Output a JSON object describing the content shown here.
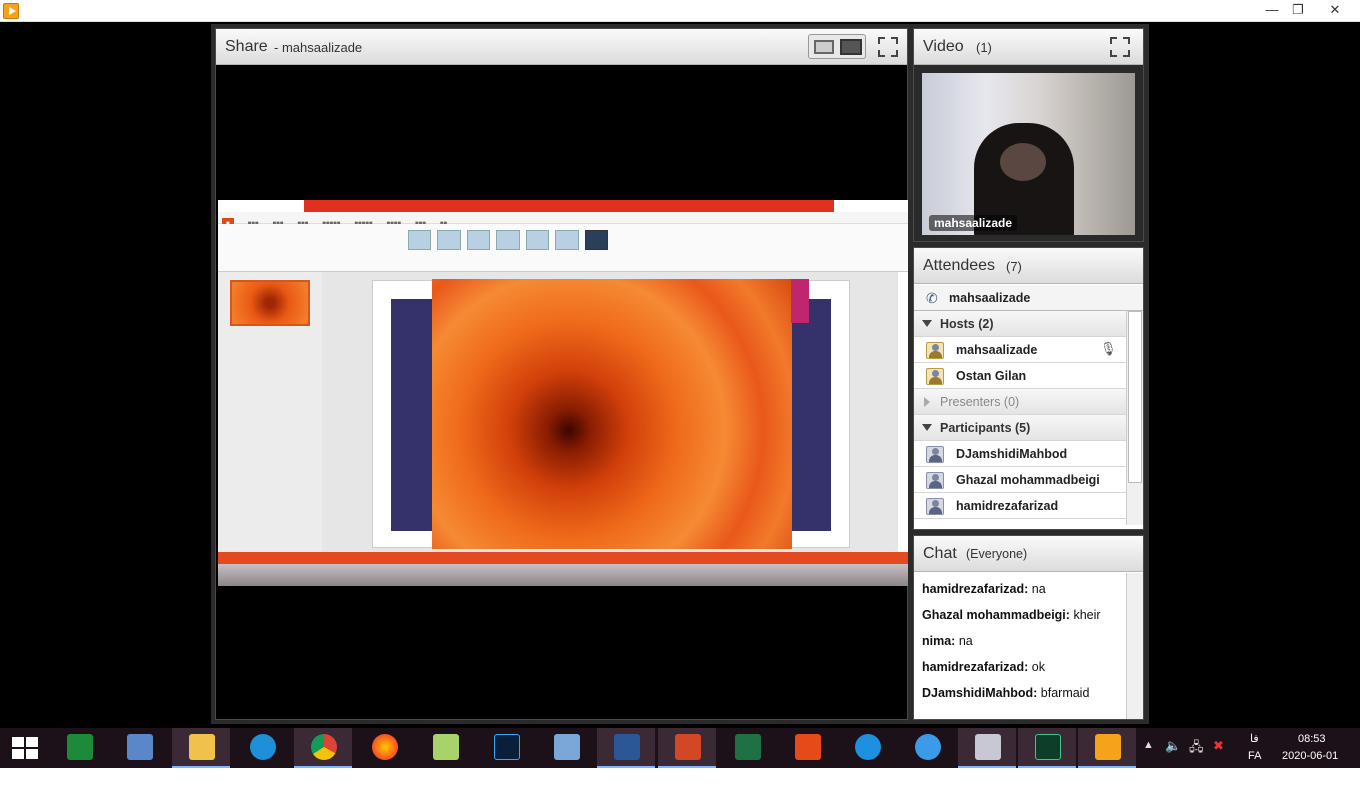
{
  "window": {
    "minimize": "—",
    "restore": "❐",
    "close": "✕"
  },
  "share": {
    "title": "Share",
    "presenter": "- mahsaalizade"
  },
  "video": {
    "title": "Video",
    "count": "(1)",
    "user": "mahsaalizade"
  },
  "attendees": {
    "title": "Attendees",
    "count": "(7)",
    "me": "mahsaalizade",
    "hosts_label": "Hosts (2)",
    "hosts": [
      "mahsaalizade",
      "Ostan Gilan"
    ],
    "presenters_label": "Presenters (0)",
    "participants_label": "Participants (5)",
    "participants": [
      "DJamshidiMahbod",
      "Ghazal mohammadbeigi",
      "hamidrezafarizad"
    ]
  },
  "chat": {
    "title": "Chat",
    "scope": "(Everyone)",
    "messages": [
      {
        "from": "hamidrezafarizad:",
        "text": "na"
      },
      {
        "from": "Ghazal mohammadbeigi:",
        "text": "kheir"
      },
      {
        "from": "nima:",
        "text": "na"
      },
      {
        "from": "hamidrezafarizad:",
        "text": "ok"
      },
      {
        "from": "DJamshidiMahbod:",
        "text": "bfarmaid"
      }
    ]
  },
  "taskbar": {
    "items": [
      "start-icon",
      "calculator-icon",
      "remote-desktop-icon",
      "file-explorer-icon",
      "internet-explorer-icon",
      "chrome-icon",
      "firefox-icon",
      "notepad-icon",
      "photoshop-icon",
      "virtualbox-icon",
      "word-icon",
      "powerpoint-icon",
      "excel-icon",
      "office-icon",
      "edge-icon",
      "network-browser-icon",
      "remote-app-icon",
      "tool-icon",
      "adobe-connect-icon"
    ],
    "lang_glyph": "فا",
    "lang": "FA",
    "time": "08:53",
    "date": "2020-06-01"
  },
  "colors": {
    "taskbar": "#1c1118",
    "pod_border": "#4a4a4a",
    "accent_orange": "#e0311f"
  }
}
